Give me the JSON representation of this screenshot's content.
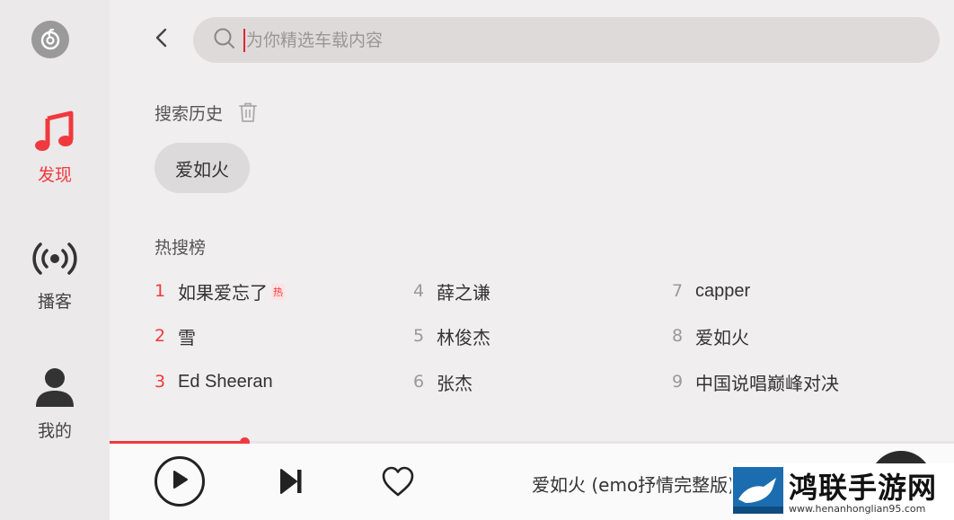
{
  "sidebar": {
    "logo_icon": "netease-music-logo-icon",
    "items": [
      {
        "label": "发现",
        "icon": "music-note-icon",
        "active": true
      },
      {
        "label": "播客",
        "icon": "broadcast-icon",
        "active": false
      },
      {
        "label": "我的",
        "icon": "user-icon",
        "active": false
      }
    ]
  },
  "search": {
    "placeholder": "为你精选车载内容"
  },
  "history": {
    "title": "搜索历史",
    "items": [
      "爱如火"
    ]
  },
  "hot": {
    "title": "热搜榜",
    "items": [
      {
        "rank": "1",
        "text": "如果爱忘了",
        "badge": "热"
      },
      {
        "rank": "2",
        "text": "雪"
      },
      {
        "rank": "3",
        "text": "Ed Sheeran"
      },
      {
        "rank": "4",
        "text": "薛之谦"
      },
      {
        "rank": "5",
        "text": "林俊杰"
      },
      {
        "rank": "6",
        "text": "张杰"
      },
      {
        "rank": "7",
        "text": "capper"
      },
      {
        "rank": "8",
        "text": "爱如火"
      },
      {
        "rank": "9",
        "text": "中国说唱巅峰对决"
      }
    ]
  },
  "player": {
    "progress": 0.16,
    "song_title": "爱如火 (emo抒情完整版)"
  },
  "watermark": {
    "name": "鸿联手游网",
    "url": "www.henanhonglian95.com"
  },
  "colors": {
    "accent": "#f0393f",
    "sidebar_bg": "#ebe9e9",
    "main_bg": "#f0eeee"
  }
}
